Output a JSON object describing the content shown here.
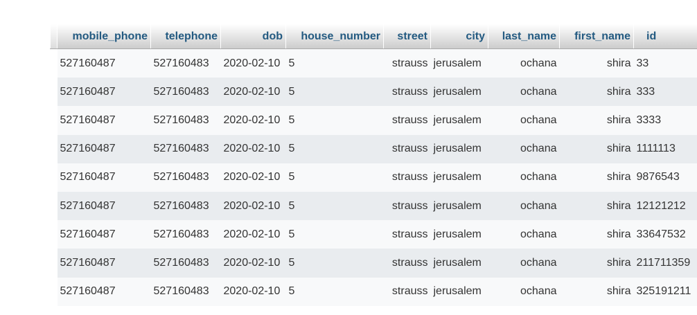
{
  "columns": [
    {
      "key": "mobile_phone",
      "label": "mobile_phone"
    },
    {
      "key": "telephone",
      "label": "telephone"
    },
    {
      "key": "dob",
      "label": "dob"
    },
    {
      "key": "house_number",
      "label": "house_number"
    },
    {
      "key": "street",
      "label": "street"
    },
    {
      "key": "city",
      "label": "city"
    },
    {
      "key": "last_name",
      "label": "last_name"
    },
    {
      "key": "first_name",
      "label": "first_name"
    },
    {
      "key": "id",
      "label": "id"
    }
  ],
  "rows": [
    {
      "mobile_phone": "527160487",
      "telephone": "527160483",
      "dob": "2020-02-10",
      "house_number": "5",
      "street": "strauss",
      "city": "jerusalem",
      "last_name": "ochana",
      "first_name": "shira",
      "id": "33"
    },
    {
      "mobile_phone": "527160487",
      "telephone": "527160483",
      "dob": "2020-02-10",
      "house_number": "5",
      "street": "strauss",
      "city": "jerusalem",
      "last_name": "ochana",
      "first_name": "shira",
      "id": "333"
    },
    {
      "mobile_phone": "527160487",
      "telephone": "527160483",
      "dob": "2020-02-10",
      "house_number": "5",
      "street": "strauss",
      "city": "jerusalem",
      "last_name": "ochana",
      "first_name": "shira",
      "id": "3333"
    },
    {
      "mobile_phone": "527160487",
      "telephone": "527160483",
      "dob": "2020-02-10",
      "house_number": "5",
      "street": "strauss",
      "city": "jerusalem",
      "last_name": "ochana",
      "first_name": "shira",
      "id": "1111113"
    },
    {
      "mobile_phone": "527160487",
      "telephone": "527160483",
      "dob": "2020-02-10",
      "house_number": "5",
      "street": "strauss",
      "city": "jerusalem",
      "last_name": "ochana",
      "first_name": "shira",
      "id": "9876543"
    },
    {
      "mobile_phone": "527160487",
      "telephone": "527160483",
      "dob": "2020-02-10",
      "house_number": "5",
      "street": "strauss",
      "city": "jerusalem",
      "last_name": "ochana",
      "first_name": "shira",
      "id": "12121212"
    },
    {
      "mobile_phone": "527160487",
      "telephone": "527160483",
      "dob": "2020-02-10",
      "house_number": "5",
      "street": "strauss",
      "city": "jerusalem",
      "last_name": "ochana",
      "first_name": "shira",
      "id": "33647532"
    },
    {
      "mobile_phone": "527160487",
      "telephone": "527160483",
      "dob": "2020-02-10",
      "house_number": "5",
      "street": "strauss",
      "city": "jerusalem",
      "last_name": "ochana",
      "first_name": "shira",
      "id": "211711359"
    },
    {
      "mobile_phone": "527160487",
      "telephone": "527160483",
      "dob": "2020-02-10",
      "house_number": "5",
      "street": "strauss",
      "city": "jerusalem",
      "last_name": "ochana",
      "first_name": "shira",
      "id": "325191211"
    }
  ],
  "colors": {
    "header_text": "#235a81",
    "row_odd": "#f8f9fa",
    "row_even": "#e9ecef",
    "cell_text": "#333333"
  }
}
